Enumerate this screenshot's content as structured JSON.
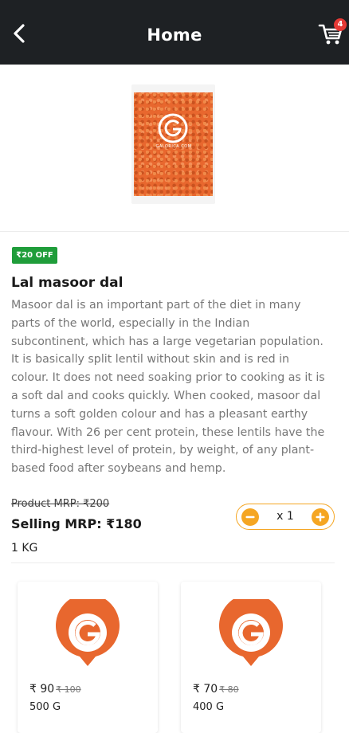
{
  "header": {
    "title": "Home",
    "cart_count": "4"
  },
  "product": {
    "image_brand": "GALORICA.COM",
    "offer": "₹20 OFF",
    "name": "Lal masoor dal",
    "description": "Masoor dal is an important part of the diet in many parts of the world, especially in the Indian subcontinent, which has a large vegetarian population. It is basically split lentil without skin and is red in colour. It does not need soaking prior to cooking as it is a soft dal and cooks quickly. When cooked, masoor dal turns a soft golden colour and has a pleasant earthy flavour. With 26 per cent protein, these lentils have the third-highest level of protein, by weight, of any plant-based food after soybeans and hemp.",
    "product_mrp": "Product MRP: ₹200",
    "selling_mrp": "Selling MRP: ₹180",
    "quantity": "x 1",
    "weight": "1 KG"
  },
  "variants": [
    {
      "price": "₹ 90",
      "old_price": "₹ 100",
      "weight": "500 G"
    },
    {
      "price": "₹ 70",
      "old_price": "₹ 80",
      "weight": "400 G"
    }
  ],
  "colors": {
    "appbar": "#1e2124",
    "accent_orange": "#f5a623",
    "offer_green": "#1f9d3a",
    "logo_orange": "#e8672e",
    "badge_red": "#e53935"
  },
  "icons": {
    "back": "chevron-left-icon",
    "cart": "cart-icon",
    "minus": "minus-circle-icon",
    "plus": "plus-circle-icon",
    "logo": "galorica-logo-icon"
  }
}
